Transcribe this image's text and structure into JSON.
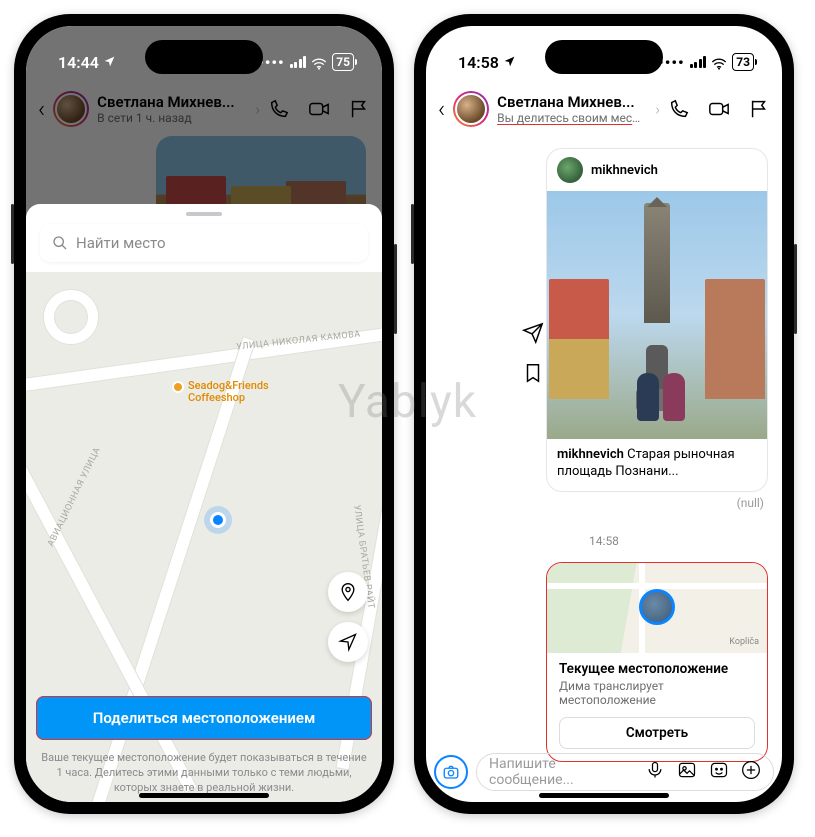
{
  "watermark": "Yablyk",
  "phone1": {
    "status": {
      "time": "14:44",
      "battery": "75"
    },
    "header": {
      "name": "Светлана Михнев...",
      "subtitle": "В сети 1 ч. назад"
    },
    "sheet": {
      "search_placeholder": "Найти место",
      "poi": {
        "line1": "Seadog&Friends",
        "line2": "Coffeeshop"
      },
      "roads": {
        "kamova": "УЛИЦА НИКОЛАЯ КАМОВА",
        "aviats": "АВИАЦИОННАЯ УЛИЦА",
        "bratiev": "УЛИЦА БРАТЬЕВ РАЙТ"
      },
      "share_label": "Поделиться местоположением",
      "disclaimer": "Ваше текущее местоположение будет показываться в течение 1 часа. Делитесь этими данными только с теми людьми, которых знаете в реальной жизни."
    }
  },
  "phone2": {
    "status": {
      "time": "14:58",
      "battery": "73"
    },
    "header": {
      "name": "Светлана Михнев...",
      "subtitle": "Вы делитесь своим местоп..."
    },
    "post": {
      "user": "mikhnevich",
      "caption_user": "mikhnevich",
      "caption_text": " Старая рыночная площадь Познани...",
      "null_label": "(null)"
    },
    "divider_time": "14:58",
    "location_card": {
      "title": "Текущее местоположение",
      "subtitle": "Дима транслирует местоположение",
      "button": "Смотреть",
      "map_label": "Kopliča"
    },
    "composer": {
      "placeholder": "Напишите сообщение..."
    }
  }
}
